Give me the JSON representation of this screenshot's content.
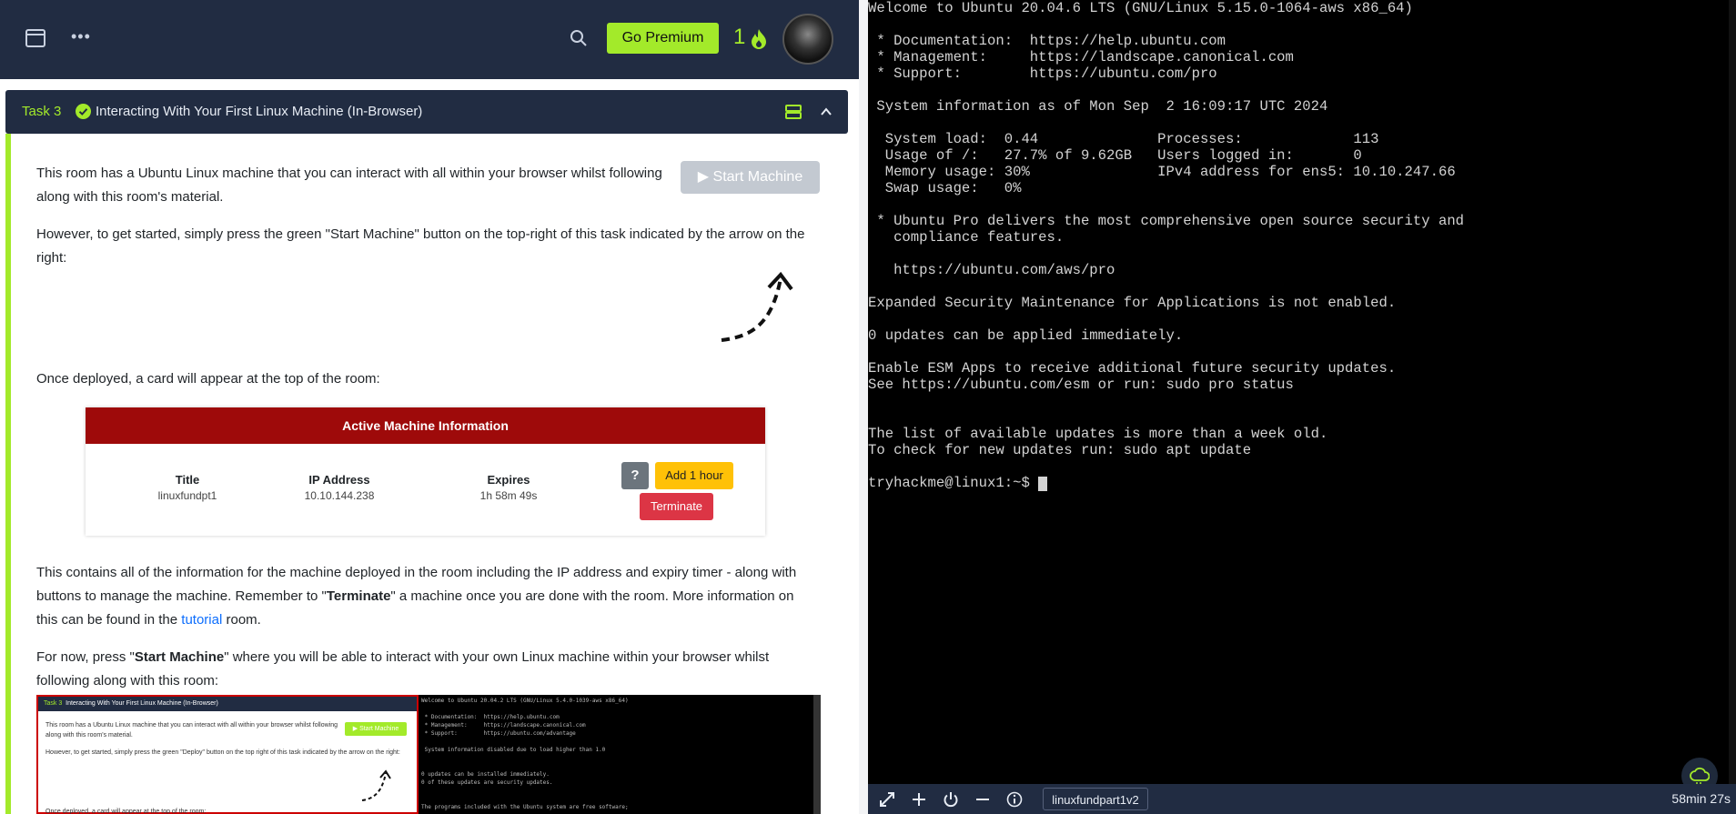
{
  "topbar": {
    "premium_label": "Go Premium",
    "streak_count": "1",
    "icons": [
      "window-icon",
      "more-icon",
      "search-icon",
      "flame-icon",
      "avatar"
    ]
  },
  "task": {
    "number": "Task 3",
    "title": "Interacting With Your First Linux Machine (In-Browser)",
    "start_label": "Start Machine",
    "para1": "This room has a Ubuntu Linux machine that you can interact with all within your browser whilst following along with this room's material.",
    "para2": "However, to get started, simply press the green \"Start Machine\" button on the top-right of this task indicated by the arrow on the right:",
    "para3": "Once deployed, a card will appear at the top of the room:",
    "para4_a": "This contains all of the information for the machine deployed in the room including the IP address and expiry timer - along with buttons to manage the machine. Remember to \"",
    "para4_b": "Terminate",
    "para4_c": "\" a machine once you are done with the room. More information on this can be found in the ",
    "para4_link": "tutorial",
    "para4_d": " room.",
    "para5_a": "For now, press \"",
    "para5_b": "Start Machine",
    "para5_c": "\" where you will be able to interact with your own Linux machine within your browser whilst following along with this room:"
  },
  "card": {
    "header": "Active Machine Information",
    "title_label": "Title",
    "title_value": "linuxfundpt1",
    "ip_label": "IP Address",
    "ip_value": "10.10.144.238",
    "expires_label": "Expires",
    "expires_value": "1h 58m 49s",
    "help_label": "?",
    "add_hour_label": "Add 1 hour",
    "terminate_label": "Terminate"
  },
  "screenshot": {
    "head_num": "Task 3",
    "head_title": "Interacting With Your First Linux Machine (In-Browser)",
    "start_label": "Start Machine",
    "p1": "This room has a Ubuntu Linux machine that you can interact with all within your browser whilst following along with this room's material.",
    "p2": "However, to get started, simply press the green \"Deploy\" button on the top right of this task indicated by the arrow on the right:",
    "p3": "Once deployed, a card will appear at the top of the room:",
    "terminal": "Welcome to Ubuntu 20.04.2 LTS (GNU/Linux 5.4.0-1039-aws x86_64)\n\n * Documentation:  https://help.ubuntu.com\n * Management:     https://landscape.canonical.com\n * Support:        https://ubuntu.com/advantage\n\n System information disabled due to load higher than 1.0\n\n\n0 updates can be installed immediately.\n0 of these updates are security updates.\n\n\nThe programs included with the Ubuntu system are free software;"
  },
  "terminal": {
    "text": "Welcome to Ubuntu 20.04.6 LTS (GNU/Linux 5.15.0-1064-aws x86_64)\n\n * Documentation:  https://help.ubuntu.com\n * Management:     https://landscape.canonical.com\n * Support:        https://ubuntu.com/pro\n\n System information as of Mon Sep  2 16:09:17 UTC 2024\n\n  System load:  0.44              Processes:             113\n  Usage of /:   27.7% of 9.62GB   Users logged in:       0\n  Memory usage: 30%               IPv4 address for ens5: 10.10.247.66\n  Swap usage:   0%\n\n * Ubuntu Pro delivers the most comprehensive open source security and\n   compliance features.\n\n   https://ubuntu.com/aws/pro\n\nExpanded Security Maintenance for Applications is not enabled.\n\n0 updates can be applied immediately.\n\nEnable ESM Apps to receive additional future security updates.\nSee https://ubuntu.com/esm or run: sudo pro status\n\n\nThe list of available updates is more than a week old.\nTo check for new updates run: sudo apt update\n\n",
    "prompt": "tryhackme@linux1:~$ "
  },
  "bottombar": {
    "machine_name": "linuxfundpart1v2",
    "timer": "58min 27s",
    "icons": [
      "expand-icon",
      "plus-icon",
      "power-icon",
      "minus-icon",
      "info-icon"
    ]
  },
  "colors": {
    "navy": "#212c42",
    "accent_green": "#a3ea2a",
    "card_red": "#9e0a0a",
    "terminate_red": "#dc3545",
    "add_hour_yellow": "#ffc107"
  }
}
